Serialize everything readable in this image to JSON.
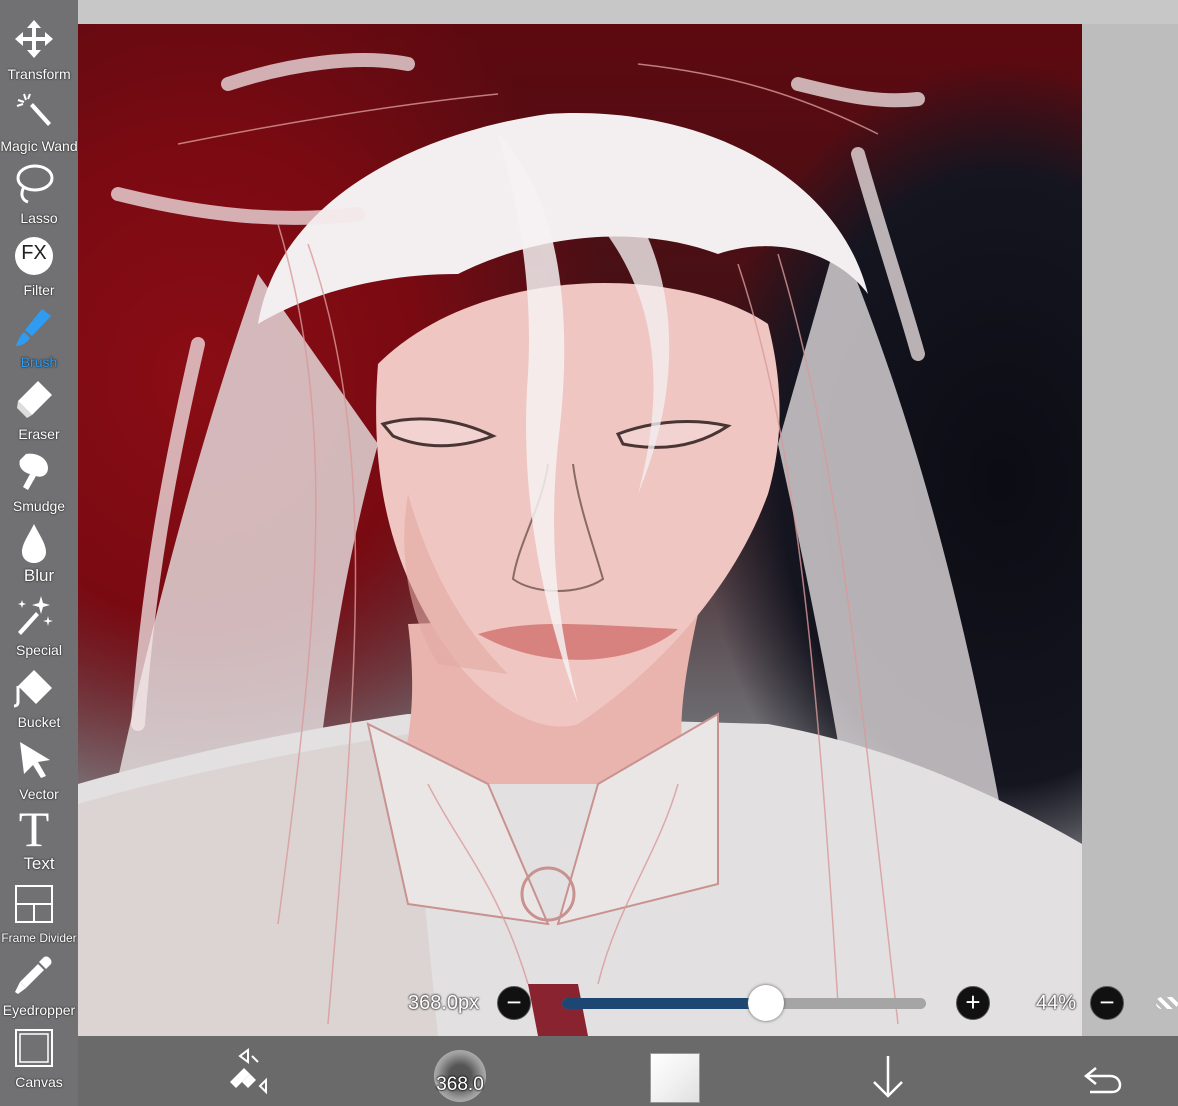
{
  "toolbar": {
    "items": [
      {
        "label": "Transform",
        "icon": "move-arrows-icon"
      },
      {
        "label": "Magic Wand",
        "icon": "magic-wand-icon"
      },
      {
        "label": "Lasso",
        "icon": "lasso-icon"
      },
      {
        "label": "Filter",
        "icon": "fx-filter-icon",
        "icon_text": "FX"
      },
      {
        "label": "Brush",
        "icon": "brush-icon",
        "active": true
      },
      {
        "label": "Eraser",
        "icon": "eraser-icon"
      },
      {
        "label": "Smudge",
        "icon": "smudge-finger-icon"
      },
      {
        "label": "Blur",
        "icon": "blur-drop-icon"
      },
      {
        "label": "Special",
        "icon": "special-sparkle-icon"
      },
      {
        "label": "Bucket",
        "icon": "bucket-icon"
      },
      {
        "label": "Vector",
        "icon": "vector-cursor-icon"
      },
      {
        "label": "Text",
        "icon": "text-t-icon",
        "icon_text": "T"
      },
      {
        "label": "Frame Divider",
        "icon": "frame-divider-icon"
      },
      {
        "label": "Eyedropper",
        "icon": "eyedropper-icon"
      },
      {
        "label": "Canvas",
        "icon": "canvas-icon"
      }
    ],
    "active_color": "#2f9cf3"
  },
  "brush_size": {
    "value_label": "368.0px",
    "fraction": 0.56,
    "fill_color": "#1e4672"
  },
  "opacity": {
    "value_label": "44%"
  },
  "bottom_bar": {
    "brush_preview_label": "368.0",
    "icons": [
      "swap-brush-eraser-icon",
      "brush-preview-icon",
      "color-swatch-icon",
      "download-arrow-icon",
      "undo-icon"
    ]
  }
}
